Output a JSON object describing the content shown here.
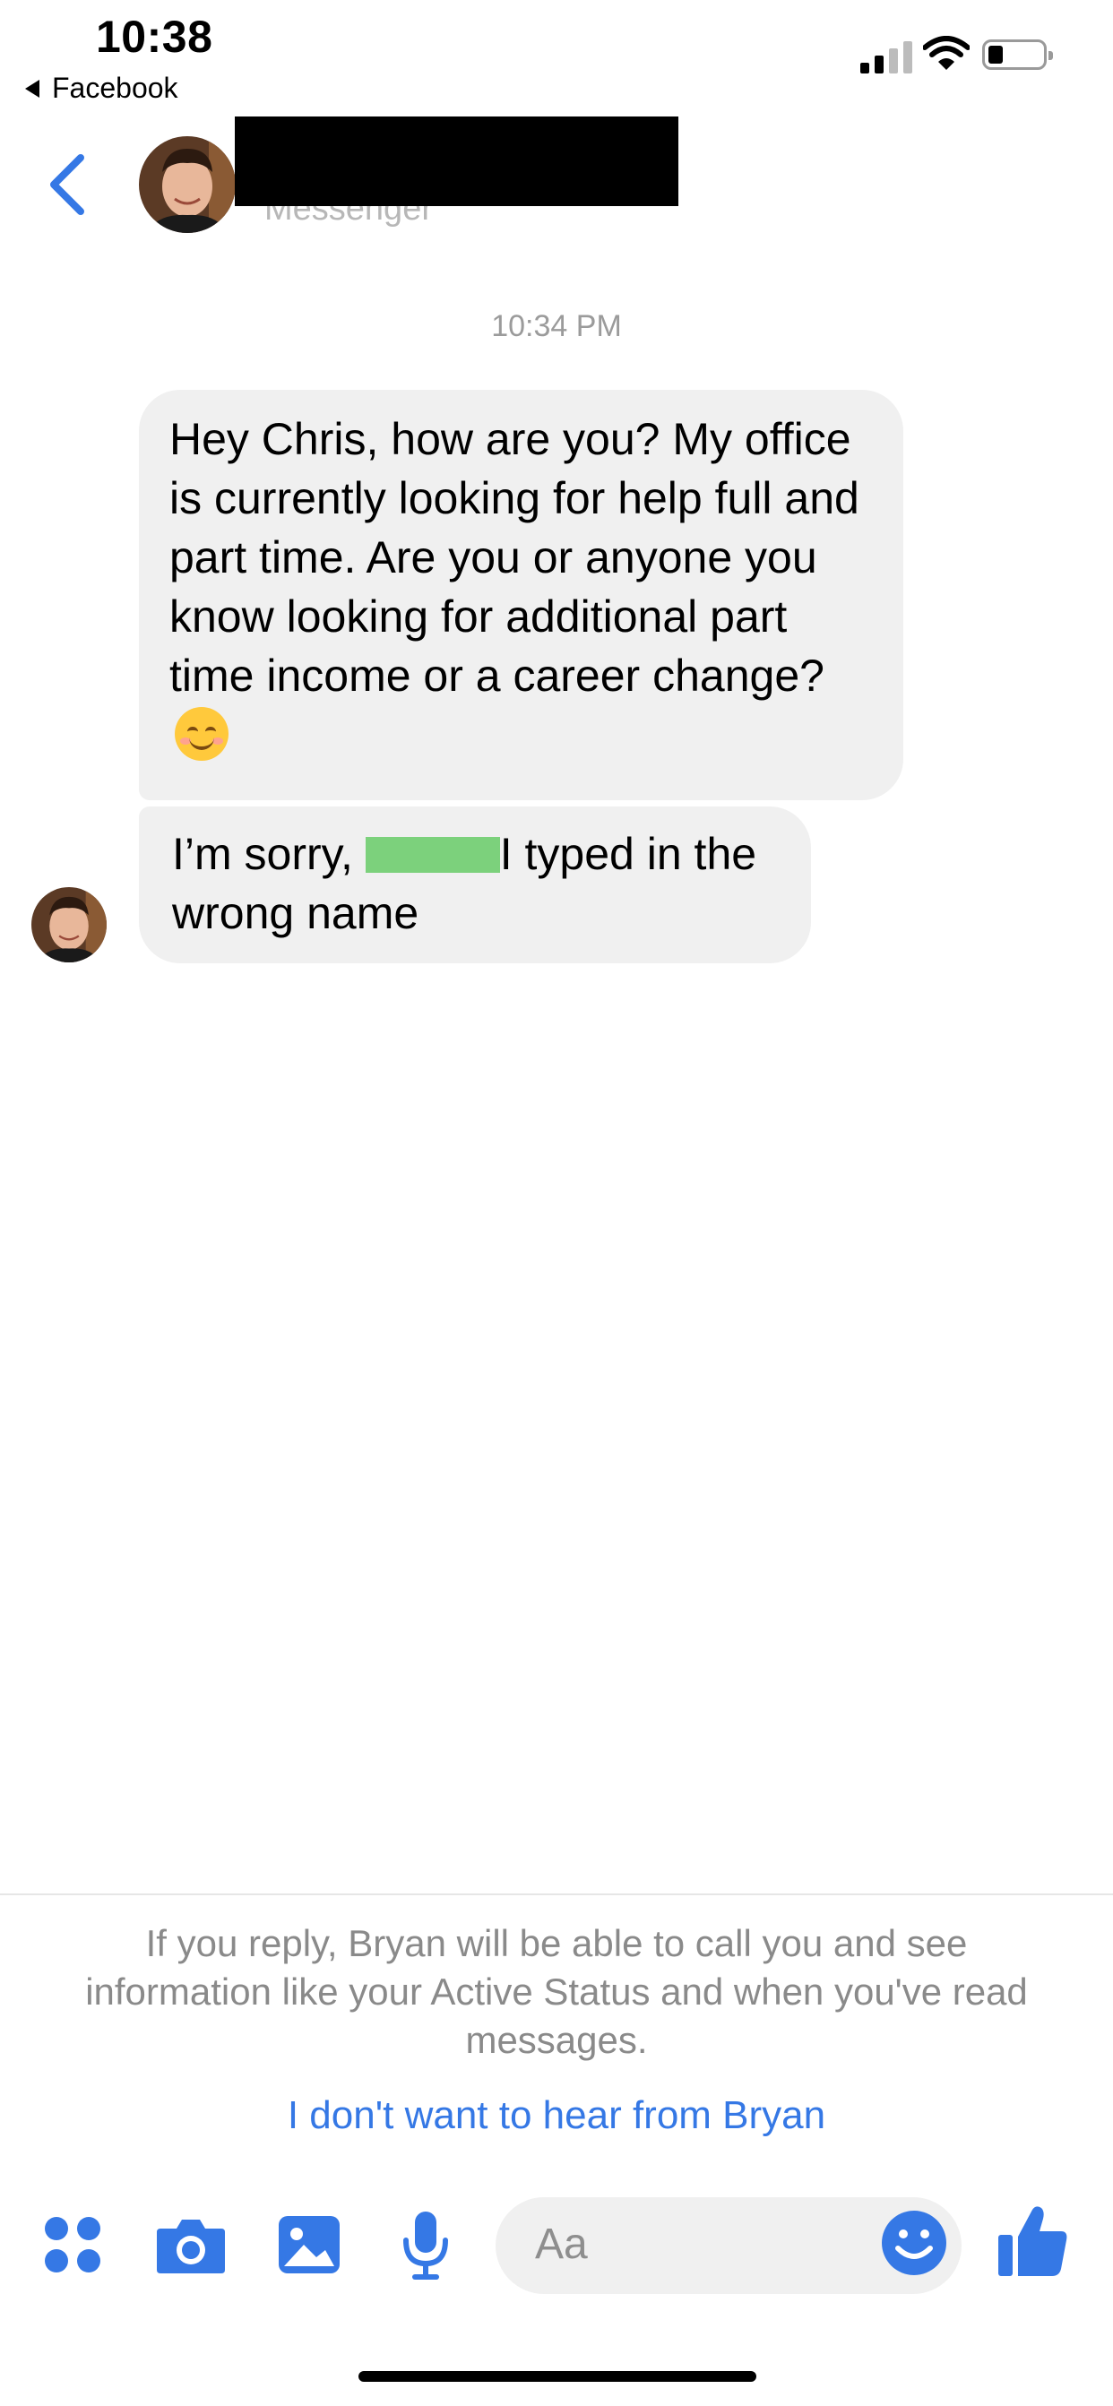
{
  "status_bar": {
    "time": "10:38",
    "back_app_label": "Facebook"
  },
  "header": {
    "subtitle": "Messenger"
  },
  "conversation": {
    "timestamp": "10:34 PM",
    "messages": [
      {
        "text": "Hey Chris, how are you? My office is currently looking for help full and part time. Are you or anyone you know looking for additional part time income or a career change?",
        "emoji": "😊"
      },
      {
        "text_before": "I’m sorry,",
        "text_after": "I typed in the wrong name"
      }
    ]
  },
  "request_notice": {
    "text": "If you reply, Bryan will be able to call you and see information like your Active Status and when you've read messages.",
    "ignore_link": "I don't want to hear from Bryan"
  },
  "composer": {
    "placeholder": "Aa"
  },
  "colors": {
    "accent": "#3578e5",
    "bubble": "#f0f0f0",
    "muted_text": "#8a8a8a",
    "redaction_black": "#000000",
    "redaction_green": "#7cd17c"
  },
  "icons": [
    "back-triangle-icon",
    "signal-icon",
    "wifi-icon",
    "battery-icon",
    "chevron-left-icon",
    "more-apps-icon",
    "camera-icon",
    "gallery-icon",
    "microphone-icon",
    "emoji-icon",
    "thumbs-up-icon"
  ]
}
